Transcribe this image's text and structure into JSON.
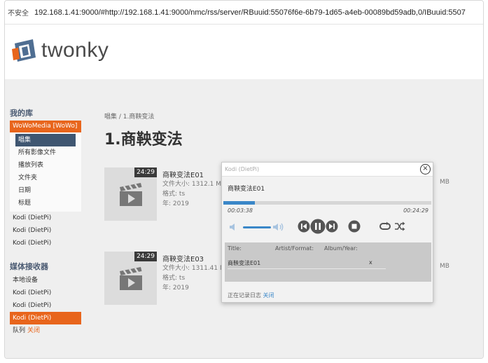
{
  "urlbar": {
    "insecure_label": "不安全",
    "url": "192.168.1.41:9000/#http://192.168.1.41:9000/nmc/rss/server/RBuuid:55076f6e-6b79-1d65-a4eb-00089bd59adb,0/IBuuid:5507"
  },
  "header": {
    "logo_text": "twonky"
  },
  "sidebar": {
    "library_heading": "我的库",
    "selected_server": "WoWoMedia [WoWo]",
    "sub_items": [
      "唱集",
      "所有影像文件",
      "播放列表",
      "文件夹",
      "日期",
      "标题"
    ],
    "library_devices": [
      "Kodi (DietPi)",
      "Kodi (DietPi)",
      "Kodi (DietPi)"
    ],
    "renderer_heading": "媒体接收器",
    "renderers": [
      "本地设备",
      "Kodi (DietPi)",
      "Kodi (DietPi)",
      "Kodi (DietPi)"
    ],
    "queue_label": "队列",
    "queue_close": "关闭"
  },
  "main": {
    "breadcrumb": "唱集 / 1.商鞅变法",
    "title": "1.商鞅变法",
    "items": [
      {
        "duration": "24:29",
        "title": "商鞅变法E01",
        "size_label": "文件大小:",
        "size": "1312.1 MB",
        "format_label": "格式:",
        "format": "ts",
        "year_label": "年:",
        "year": "2019",
        "size_unit_tail": "MB"
      },
      {
        "duration": "24:29",
        "title": "商鞅变法E03",
        "size_label": "文件大小:",
        "size": "1311.41 MB",
        "format_label": "格式:",
        "format": "ts",
        "year_label": "年:",
        "year": "2019",
        "size_unit_tail": "MB"
      }
    ]
  },
  "player": {
    "device_name": "Kodi (DietPi)",
    "close_icon": "close-icon",
    "now_playing": "商鞅变法E01",
    "elapsed": "00:03:38",
    "total": "00:24:29",
    "progress": 0.15,
    "volume": 0.7,
    "queue_headers": {
      "title": "Title:",
      "artist": "Artist/Format:",
      "album": "Album/Year:"
    },
    "queue_rows": [
      {
        "title": "商鞅变法E01",
        "remove": "x"
      }
    ],
    "log_label": "正在记录日志",
    "log_close": "关闭"
  },
  "colors": {
    "accent_orange": "#e8651c",
    "nav_blue": "#3f5671",
    "progress_blue": "#3a87c8"
  }
}
